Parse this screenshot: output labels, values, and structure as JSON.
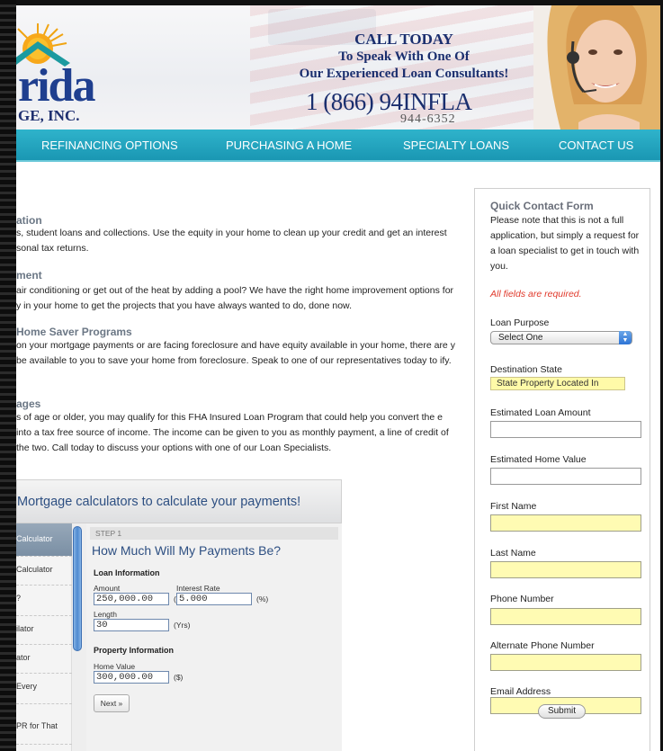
{
  "header": {
    "logo_text": "rida",
    "logo_subtext": "GE, INC.",
    "call_line1": "CALL TODAY",
    "call_line2": "To Speak With One Of",
    "call_line3": "Our Experienced Loan Consultants!",
    "phone_main": "1  (866) 94INFLA",
    "phone_numeric": "944-6352"
  },
  "nav": {
    "items": [
      {
        "label": "REFINANCING OPTIONS"
      },
      {
        "label": "PURCHASING A HOME"
      },
      {
        "label": "SPECIALTY LOANS"
      },
      {
        "label": "CONTACT US"
      }
    ]
  },
  "content": {
    "sections": [
      {
        "heading": "ation",
        "text": "s, student loans and collections. Use the equity in your home to clean up your credit and get an interest sonal tax returns."
      },
      {
        "heading": "ment",
        "text": "air conditioning or get out of the heat by adding a pool? We have the right home improvement options for y in your home to get the projects that you have always wanted to do, done now."
      },
      {
        "heading": "Home Saver Programs",
        "text": "on your mortgage payments or are facing foreclosure and have equity available in your home, there are y be available to you to save your home from foreclosure. Speak to one of our representatives today to ify."
      },
      {
        "heading": "ages",
        "text": "s of age or older, you may qualify for this FHA Insured Loan Program that could help you convert the e into a tax free source of income. The income can be given to you as monthly payment, a line of credit of the two. Call today to discuss your options with one of our Loan Specialists."
      }
    ]
  },
  "calculator": {
    "header_title": "Mortgage calculators to calculate your payments!",
    "left_items": [
      "Calculator",
      "Calculator",
      "?",
      "ilator",
      "ator",
      "Every",
      "PR for That"
    ],
    "step_label": "STEP 1",
    "question": "How Much Will My Payments Be?",
    "loan_info_label": "Loan Information",
    "amount_label": "Amount",
    "amount_value": "250,000.00",
    "amount_unit": "($)",
    "rate_label": "Interest Rate",
    "rate_value": "5.000",
    "rate_unit": "(%)",
    "length_label": "Length",
    "length_value": "30",
    "length_unit": "(Yrs)",
    "property_label": "Property Information",
    "home_value_label": "Home Value",
    "home_value_value": "300,000.00",
    "home_value_unit": "($)",
    "next_label": "Next »"
  },
  "quick_form": {
    "title": "Quick Contact Form",
    "description": "Please note that this is not a full application, but simply a request for a loan specialist to get in touch with you.",
    "required_note": "All fields are required.",
    "loan_purpose_label": "Loan Purpose",
    "loan_purpose_value": "Select One",
    "destination_label": "Destination State",
    "destination_value": "State Property Located In",
    "loan_amount_label": "Estimated Loan Amount",
    "home_value_label": "Estimated Home Value",
    "first_name_label": "First Name",
    "last_name_label": "Last Name",
    "phone_label": "Phone Number",
    "alt_phone_label": "Alternate Phone Number",
    "email_label": "Email Address",
    "submit_label": "Submit"
  },
  "colors": {
    "nav_bg": "#1a97b3",
    "heading_blue": "#1a2e6e",
    "required_red": "#e0392b",
    "field_yellow": "#fffbb3"
  }
}
